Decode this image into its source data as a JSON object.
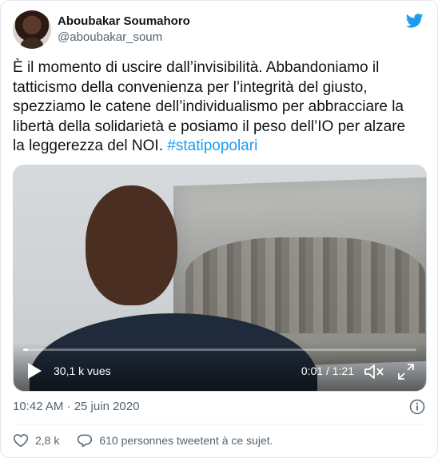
{
  "author": {
    "display_name": "Aboubakar Soumahoro",
    "handle": "@aboubakar_soum"
  },
  "tweet": {
    "text": "È il momento di uscire dall’invisibilità. Abbandoniamo il tatticismo della convenienza per l’integrità del giusto, spezziamo le catene dell’individualismo per abbracciare la libertà della solidarietà e posiamo il peso dell’IO per alzare la leggerezza del NOI.",
    "hashtag": "#statipopolari"
  },
  "video": {
    "views": "30,1 k vues",
    "time": "0:01 / 1:21",
    "progress_fraction": 0.012
  },
  "meta": {
    "timestamp": "10:42 AM · 25 juin 2020"
  },
  "actions": {
    "likes": "2,8 k",
    "comments_text": "610 personnes tweetent à ce sujet."
  },
  "colors": {
    "accent": "#1d9bf0",
    "muted": "#536471",
    "text": "#0f1419"
  },
  "icons": {
    "brand": "twitter-bird-icon",
    "play": "play-icon",
    "volume": "volume-icon",
    "fullscreen": "fullscreen-icon",
    "info": "info-icon",
    "like": "heart-icon",
    "reply": "reply-bubble-icon"
  }
}
